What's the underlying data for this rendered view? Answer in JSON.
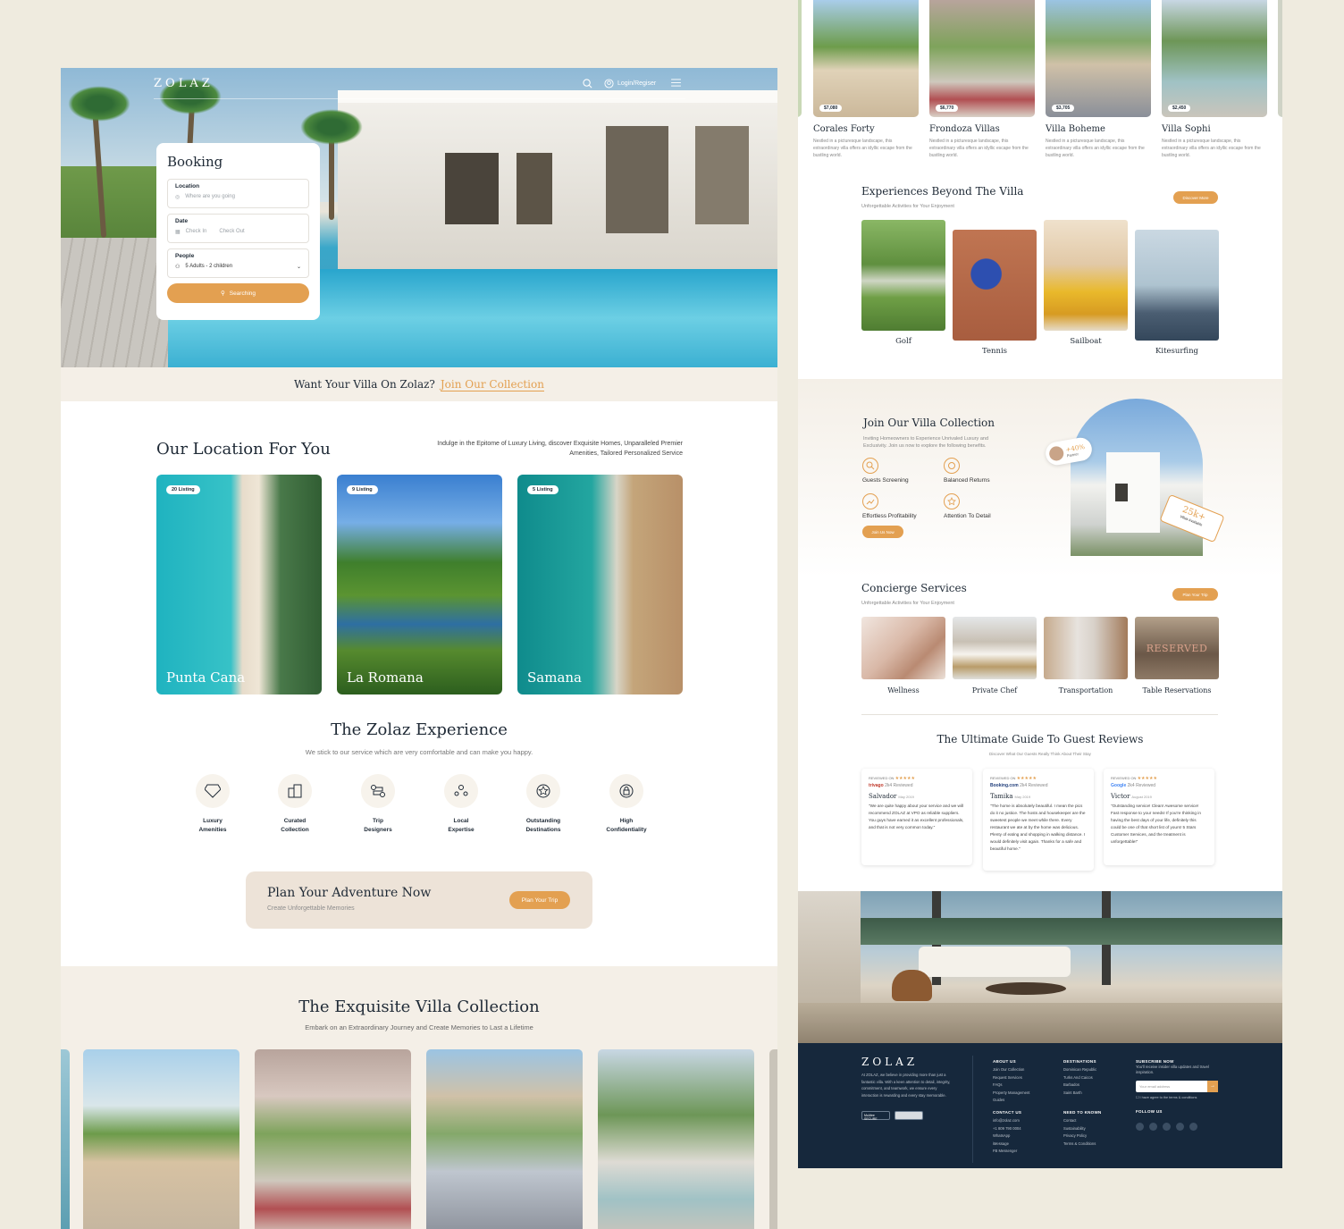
{
  "left": {
    "nav": {
      "logo": "ZOLAZ",
      "login": "Login/Regiser"
    },
    "booking": {
      "title": "Booking",
      "location_label": "Location",
      "location_placeholder": "Where are you going",
      "date_label": "Date",
      "checkin": "Check In",
      "checkout": "Check Out",
      "people_label": "People",
      "people_value": "5 Adults - 2 children",
      "search_button": "Searching"
    },
    "join_bar": {
      "text": "Want Your Villa On Zolaz?",
      "link": "Join Our Collection"
    },
    "locations": {
      "title": "Our Location For You",
      "description": "Indulge in the Epitome of Luxury Living, discover Exquisite Homes, Unparalleled Premier Amenities, Tailored Personalized Service",
      "cards": [
        {
          "badge": "20 Listing",
          "name": "Punta Cana"
        },
        {
          "badge": "9 Listing",
          "name": "La Romana"
        },
        {
          "badge": "5 Listing",
          "name": "Samana"
        }
      ]
    },
    "experience": {
      "title": "The Zolaz Experience",
      "subtitle": "We stick to our service which are very comfortable and can make you happy.",
      "features": [
        {
          "l1": "Luxury",
          "l2": "Amenities",
          "icon": "diamond-icon"
        },
        {
          "l1": "Curated",
          "l2": "Collection",
          "icon": "buildings-icon"
        },
        {
          "l1": "Trip",
          "l2": "Designers",
          "icon": "route-icon"
        },
        {
          "l1": "Local",
          "l2": "Expertise",
          "icon": "people-icon"
        },
        {
          "l1": "Outstanding",
          "l2": "Destinations",
          "icon": "star-badge-icon"
        },
        {
          "l1": "High",
          "l2": "Confidentiality",
          "icon": "lock-icon"
        }
      ]
    },
    "plan": {
      "title": "Plan Your Adventure Now",
      "subtitle": "Create Unforgettable Memories",
      "button": "Plan Your Trip"
    },
    "collection": {
      "title": "The Exquisite Villa Collection",
      "subtitle": "Embark on an Extraordinary Journey and Create Memories to Last a Lifetime"
    }
  },
  "right": {
    "villas": [
      {
        "name": "Corales Forty",
        "price": "$7,080",
        "desc": "Nestled in a picturesque landscape, this extraordinary villa offers an idyllic escape from the bustling world."
      },
      {
        "name": "Frondoza Villas",
        "price": "$6,770",
        "desc": "Nestled in a picturesque landscape, this extraordinary villa offers an idyllic escape from the bustling world."
      },
      {
        "name": "Villa Boheme",
        "price": "$3,705",
        "desc": "Nestled in a picturesque landscape, this extraordinary villa offers an idyllic escape from the bustling world."
      },
      {
        "name": "Villa Sophi",
        "price": "$2,450",
        "desc": "Nestled in a picturesque landscape, this extraordinary villa offers an idyllic escape from the bustling world."
      }
    ],
    "experiences": {
      "title": "Experiences Beyond The Villa",
      "subtitle": "Unforgettable Activities for Your Enjoyment",
      "button": "Discover More",
      "items": [
        "Golf",
        "Tennis",
        "Sailboat",
        "Kitesurfing"
      ]
    },
    "join": {
      "title": "Join Our Villa Collection",
      "subtitle": "Inviting Homeowners to Experience Unrivaled Luxury and Exclusivity. Join us now to explore the following benefits.",
      "benefits": [
        "Guests Screening",
        "Balanced Returns",
        "Effortless Profitability",
        "Attention To Detail"
      ],
      "button": "Join Us Now",
      "badge_partner": "+40%",
      "badge_partner_sub": "Partner",
      "badge_villas": "25k+",
      "badge_villas_sub": "Villas Available"
    },
    "concierge": {
      "title": "Concierge Services",
      "subtitle": "Unforgettable Activities for Your Enjoyment",
      "button": "Plan Your Trip",
      "items": [
        "Wellness",
        "Private Chef",
        "Transportation",
        "Table Reservations"
      ],
      "reserved_sign": "RESERVED"
    },
    "reviews": {
      "title": "The Ultimate Guide To Guest Reviews",
      "subtitle": "Discover What Our Guests Really Think About Their Stay",
      "items": [
        {
          "reviewed": "REVIEWED ON",
          "stars": "★★★★★",
          "source": "trivago",
          "count": "2k4 Reviewed",
          "name": "Salvador",
          "date": "May 2019",
          "text": "\"We are quite happy about your service and we will recommend ZOLAZ at VPO as reliable suppliers. You guys have earned it as excellent professionals, and that is not very common today.\""
        },
        {
          "reviewed": "REVIEWED ON",
          "stars": "★★★★★",
          "source": "Booking.com",
          "count": "2k4 Reviewed",
          "name": "Tamika",
          "date": "May 2019",
          "text": "\"The home is absolutely beautiful. I mean the pics do it no justice. The hosts and housekeeper are the sweetest people we meet while there. Every restaurant we ate at by the home was delicious. Plenty of eating and shopping in walking distance. I would definitely visit again. Thanks for a safe and beautiful home.\""
        },
        {
          "reviewed": "REVIEWED ON",
          "stars": "★★★★★",
          "source": "Google",
          "count": "2k4 Reviewed",
          "name": "Victor",
          "date": "August 2019",
          "text": "\"Outstanding service! Clean! Awesome service! Fast response to your needs! If you're thinking in having the best days of your life, definitely this could be one of that short list of yours! 5 Stars Customer Services, and the treatment is unforgettable!\""
        }
      ]
    },
    "footer": {
      "logo": "ZOLAZ",
      "about": "At ZOLAZ, we believe in providing more than just a fantastic villa. With a keen attention to detail, integrity, commitment, and teamwork, we ensure every interaction is rewarding and every stay memorable.",
      "badge1": "McAfee SECURE",
      "about_us_h": "ABOUT US",
      "about_us": [
        "Join Our Collection",
        "Request Services",
        "FAQs",
        "Property Management",
        "Guides"
      ],
      "contact_h": "CONTACT US",
      "contact": [
        "info@zolaz.com",
        "+1 809 790 0004",
        "WhatsApp",
        "iMessage",
        "FB Messenger"
      ],
      "dest_h": "DESTINATIONS",
      "dest": [
        "Dominican Republic",
        "Turks And Caicos",
        "Barbados",
        "Saint Barth"
      ],
      "need_h": "NEED TO KNOWN",
      "need": [
        "Contact",
        "Sustainability",
        "Privacy Policy",
        "Terms & Conditions"
      ],
      "subscribe_h": "SUBSCRIBE NOW",
      "subscribe_text": "You'll receive insider villa updates and travel inspiration.",
      "email_placeholder": "Your email address",
      "agree": "I have agree to the terms & conditions",
      "follow_h": "FOLLOW US"
    }
  },
  "colors": {
    "accent": "#e3a051",
    "navy": "#16283c",
    "cream": "#f4efe7",
    "page_bg": "#efebdf"
  }
}
